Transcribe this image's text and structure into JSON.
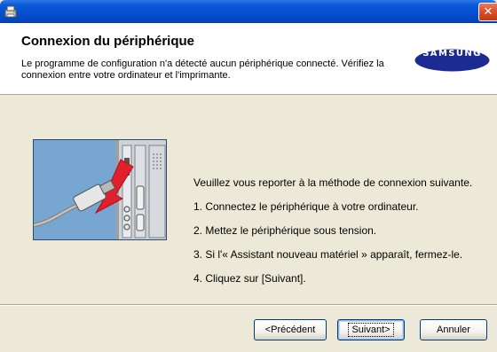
{
  "window": {
    "close_glyph": "✕",
    "app_icon": "installer-icon"
  },
  "header": {
    "title": "Connexion du périphérique",
    "subtitle": "Le programme de configuration n'a détecté aucun périphérique connecté. Vérifiez la connexion entre votre ordinateur et l'imprimante.",
    "logo_text": "SAMSUNG",
    "logo_color": "#1c2a94"
  },
  "instructions": {
    "intro": "Veuillez vous reporter à la méthode de connexion suivante.",
    "steps": [
      "1. Connectez le périphérique à votre ordinateur.",
      "2. Mettez le périphérique sous tension.",
      "3. Si l'« Assistant nouveau matériel » apparaît, fermez-le.",
      "4. Cliquez sur [Suivant]."
    ]
  },
  "illustration": {
    "icon": "usb-cable-connection-image",
    "arrow_color": "#e0202c"
  },
  "buttons": {
    "previous": "<Précédent",
    "next": "Suivant>",
    "cancel": "Annuler"
  }
}
